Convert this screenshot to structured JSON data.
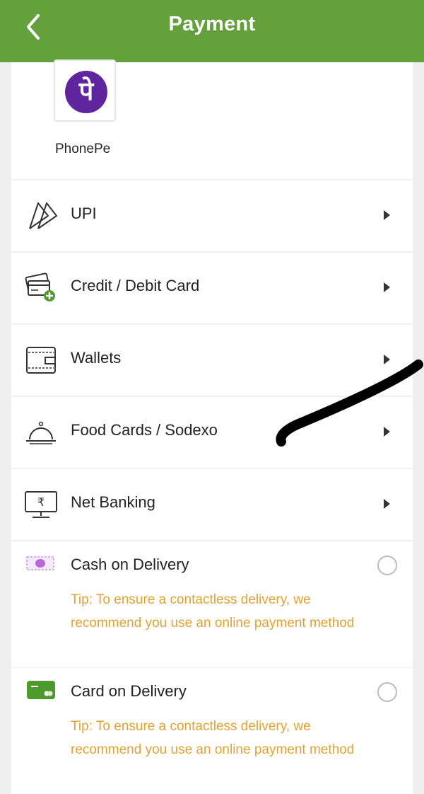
{
  "header": {
    "title": "Payment",
    "back_icon": "chevron-left-icon"
  },
  "phonepe": {
    "logo_glyph": "पे",
    "label": "PhonePe",
    "brand_color": "#5f259f"
  },
  "methods": [
    {
      "label": "UPI",
      "icon": "upi-icon"
    },
    {
      "label": "Credit / Debit Card",
      "icon": "credit-card-add-icon"
    },
    {
      "label": "Wallets",
      "icon": "wallet-icon"
    },
    {
      "label": "Food Cards / Sodexo",
      "icon": "food-cloche-icon"
    },
    {
      "label": "Net Banking",
      "icon": "net-banking-icon"
    }
  ],
  "delivery_options": [
    {
      "label": "Cash on Delivery",
      "icon": "cash-icon",
      "selected": false,
      "tip": "Tip: To ensure a contactless delivery, we recommend you use an online payment method"
    },
    {
      "label": "Card on Delivery",
      "icon": "card-icon",
      "selected": false,
      "tip": "Tip: To ensure a contactless delivery, we recommend you use an online payment method"
    }
  ],
  "colors": {
    "header": "#64a03c",
    "tip": "#e2a233",
    "background": "#efefef"
  }
}
